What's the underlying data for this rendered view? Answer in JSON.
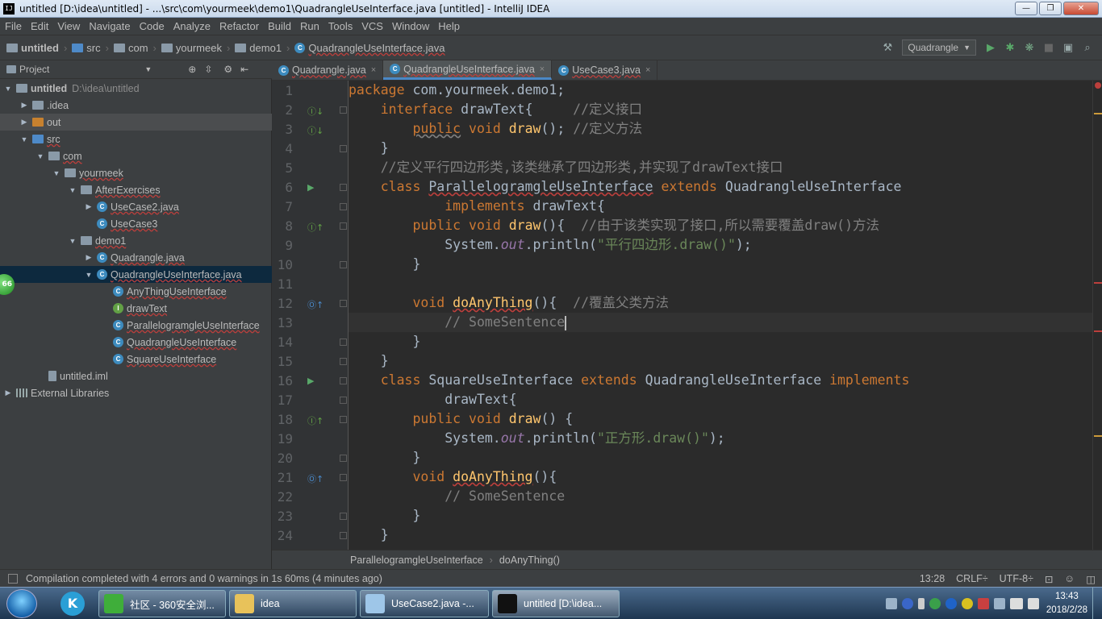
{
  "window": {
    "title": "untitled [D:\\idea\\untitled] - ...\\src\\com\\yourmeek\\demo1\\QuadrangleUseInterface.java [untitled] - IntelliJ IDEA",
    "app_icon": "IJ"
  },
  "menu": [
    "File",
    "Edit",
    "View",
    "Navigate",
    "Code",
    "Analyze",
    "Refactor",
    "Build",
    "Run",
    "Tools",
    "VCS",
    "Window",
    "Help"
  ],
  "breadcrumb": [
    "untitled",
    "src",
    "com",
    "yourmeek",
    "demo1",
    "QuadrangleUseInterface.java"
  ],
  "toolbar": {
    "run_config": "Quadrangle"
  },
  "project": {
    "header": "Project",
    "tree": [
      {
        "label": "untitled",
        "extra": "D:\\idea\\untitled",
        "indent": 0,
        "arrow": "▼",
        "icon": "folder"
      },
      {
        "label": ".idea",
        "indent": 1,
        "arrow": "▶",
        "icon": "folder"
      },
      {
        "label": "out",
        "indent": 1,
        "arrow": "▶",
        "icon": "folder-orange"
      },
      {
        "label": "src",
        "indent": 1,
        "arrow": "▼",
        "icon": "folder-blue"
      },
      {
        "label": "com",
        "indent": 2,
        "arrow": "▼",
        "icon": "folder"
      },
      {
        "label": "yourmeek",
        "indent": 3,
        "arrow": "▼",
        "icon": "folder"
      },
      {
        "label": "AfterExercises",
        "indent": 4,
        "arrow": "▼",
        "icon": "folder"
      },
      {
        "label": "UseCase2.java",
        "indent": 5,
        "arrow": "▶",
        "icon": "class"
      },
      {
        "label": "UseCase3",
        "indent": 5,
        "arrow": "",
        "icon": "class"
      },
      {
        "label": "demo1",
        "indent": 4,
        "arrow": "▼",
        "icon": "folder"
      },
      {
        "label": "Quadrangle.java",
        "indent": 5,
        "arrow": "▶",
        "icon": "class"
      },
      {
        "label": "QuadrangleUseInterface.java",
        "indent": 5,
        "arrow": "▼",
        "icon": "class",
        "selected": true
      },
      {
        "label": "AnyThingUseInterface",
        "indent": 6,
        "arrow": "",
        "icon": "class"
      },
      {
        "label": "drawText",
        "indent": 6,
        "arrow": "",
        "icon": "interface"
      },
      {
        "label": "ParallelogramgleUseInterface",
        "indent": 6,
        "arrow": "",
        "icon": "class"
      },
      {
        "label": "QuadrangleUseInterface",
        "indent": 6,
        "arrow": "",
        "icon": "class"
      },
      {
        "label": "SquareUseInterface",
        "indent": 6,
        "arrow": "",
        "icon": "class"
      },
      {
        "label": "untitled.iml",
        "indent": 2,
        "arrow": "",
        "icon": "file"
      },
      {
        "label": "External Libraries",
        "indent": 0,
        "arrow": "▶",
        "icon": "lib"
      }
    ]
  },
  "tabs": [
    {
      "label": "Quadrangle.java",
      "active": false
    },
    {
      "label": "QuadrangleUseInterface.java",
      "active": true
    },
    {
      "label": "UseCase3.java",
      "active": false
    }
  ],
  "line_numbers": [
    "1",
    "2",
    "3",
    "4",
    "5",
    "6",
    "7",
    "8",
    "9",
    "10",
    "11",
    "12",
    "13",
    "14",
    "15",
    "16",
    "17",
    "18",
    "19",
    "20",
    "21",
    "22",
    "23",
    "24"
  ],
  "code_lines": [
    [
      [
        "kw",
        "package "
      ],
      [
        "",
        "com.yourmeek.demo1;"
      ]
    ],
    [
      [
        "",
        "    "
      ],
      [
        "kw",
        "interface "
      ],
      [
        "",
        "drawText{     "
      ],
      [
        "cm",
        "//定义接口"
      ]
    ],
    [
      [
        "",
        "        "
      ],
      [
        "kw wavg",
        "public"
      ],
      [
        "kw",
        " void "
      ],
      [
        "fn",
        "draw"
      ],
      [
        "",
        "(); "
      ],
      [
        "cm",
        "//定义方法"
      ]
    ],
    [
      [
        "",
        "    }"
      ]
    ],
    [
      [
        "",
        "    "
      ],
      [
        "cm",
        "//定义平行四边形类,该类继承了四边形类,并实现了drawText接口"
      ]
    ],
    [
      [
        "",
        "    "
      ],
      [
        "kw",
        "class "
      ],
      [
        "wav",
        "ParallelogramgleUseInterface"
      ],
      [
        "kw",
        " extends "
      ],
      [
        "",
        "QuadrangleUseInterface"
      ]
    ],
    [
      [
        "",
        "            "
      ],
      [
        "kw",
        "implements "
      ],
      [
        "",
        "drawText{"
      ]
    ],
    [
      [
        "",
        "        "
      ],
      [
        "kw",
        "public void "
      ],
      [
        "fn",
        "draw"
      ],
      [
        "",
        "(){  "
      ],
      [
        "cm",
        "//由于该类实现了接口,所以需要覆盖draw()方法"
      ]
    ],
    [
      [
        "",
        "            System."
      ],
      [
        "fld",
        "out"
      ],
      [
        "",
        ".println("
      ],
      [
        "st",
        "\"平行四边形.draw()\""
      ],
      [
        "",
        ");"
      ]
    ],
    [
      [
        "",
        "        }"
      ]
    ],
    [
      [
        "",
        ""
      ]
    ],
    [
      [
        "",
        "        "
      ],
      [
        "kw",
        "void "
      ],
      [
        "fn wav",
        "doAnyThing"
      ],
      [
        "",
        "(){  "
      ],
      [
        "cm",
        "//覆盖父类方法"
      ]
    ],
    [
      [
        "",
        "            "
      ],
      [
        "cm",
        "// SomeSentence"
      ],
      [
        "caret",
        ""
      ]
    ],
    [
      [
        "",
        "        }"
      ]
    ],
    [
      [
        "",
        "    }"
      ]
    ],
    [
      [
        "",
        "    "
      ],
      [
        "kw",
        "class "
      ],
      [
        "",
        "SquareUseInterface"
      ],
      [
        "kw",
        " extends "
      ],
      [
        "",
        "QuadrangleUseInterface "
      ],
      [
        "kw",
        "implements"
      ]
    ],
    [
      [
        "",
        "            drawText{"
      ]
    ],
    [
      [
        "",
        "        "
      ],
      [
        "kw",
        "public void "
      ],
      [
        "fn",
        "draw"
      ],
      [
        "",
        "() {"
      ]
    ],
    [
      [
        "",
        "            System."
      ],
      [
        "fld",
        "out"
      ],
      [
        "",
        ".println("
      ],
      [
        "st",
        "\"正方形.draw()\""
      ],
      [
        "",
        ");"
      ]
    ],
    [
      [
        "",
        "        }"
      ]
    ],
    [
      [
        "",
        "        "
      ],
      [
        "kw",
        "void "
      ],
      [
        "fn wav",
        "doAnyThing"
      ],
      [
        "",
        "(){"
      ]
    ],
    [
      [
        "",
        "            "
      ],
      [
        "cm",
        "// SomeSentence"
      ]
    ],
    [
      [
        "",
        "        }"
      ]
    ],
    [
      [
        "",
        "    }"
      ]
    ]
  ],
  "editor_breadcrumb": [
    "ParallelogramgleUseInterface",
    "doAnyThing()"
  ],
  "status": {
    "message": "Compilation completed with 4 errors and 0 warnings in 1s 60ms (4 minutes ago)",
    "position": "13:28",
    "line_sep": "CRLF÷",
    "encoding": "UTF-8÷"
  },
  "taskbar": {
    "apps": [
      {
        "label": "社区 - 360安全浏...",
        "color": "#3fae3a"
      },
      {
        "label": "idea",
        "color": "#e8c25a"
      },
      {
        "label": "UseCase2.java -...",
        "color": "#9ec6e8"
      },
      {
        "label": "untitled [D:\\idea...",
        "color": "#111111",
        "active": true
      }
    ],
    "time": "13:43",
    "date": "2018/2/28"
  },
  "badge": "66",
  "colors": {
    "keyword": "#cc7832",
    "comment": "#808080",
    "string": "#6a8759",
    "method": "#ffc66d",
    "field": "#9876aa",
    "error": "#bc3f3c"
  }
}
